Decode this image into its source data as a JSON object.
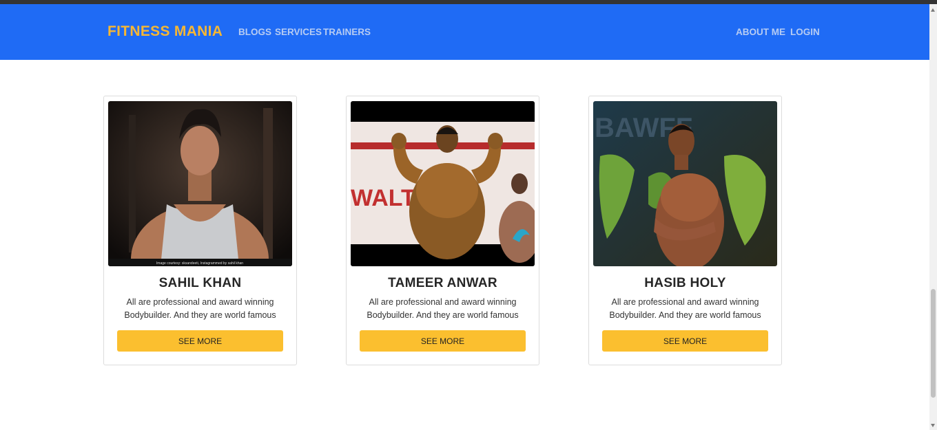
{
  "navbar": {
    "brand": "FITNESS MANIA",
    "links_left": [
      "BLOGS",
      "SERVICES",
      "TRAINERS"
    ],
    "links_right": [
      "ABOUT ME",
      "LOGIN"
    ]
  },
  "colors": {
    "navbar_bg": "#1f6bf5",
    "brand": "#f7b733",
    "button": "#fbbf2f"
  },
  "trainers": [
    {
      "name": "SAHIL KHAN",
      "description": "All are professional and award winning Bodybuilder. And they are world famous",
      "button_label": "SEE MORE",
      "image_caption": "Image courtesy: sksandeeti, Instagrammed by sahil khan"
    },
    {
      "name": "TAMEER ANWAR",
      "description": "All are professional and award winning Bodybuilder. And they are world famous",
      "button_label": "SEE MORE",
      "image_text": "WALTON"
    },
    {
      "name": "HASIB HOLY",
      "description": "All are professional and award winning Bodybuilder. And they are world famous",
      "button_label": "SEE MORE",
      "image_text": "BAWFF"
    }
  ]
}
